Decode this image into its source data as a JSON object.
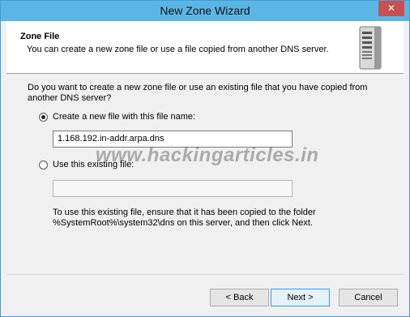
{
  "window": {
    "title": "New Zone Wizard",
    "close_glyph": "✕"
  },
  "header": {
    "title": "Zone File",
    "subtitle": "You can create a new zone file or use a file copied from another DNS server.",
    "icon": "server-icon"
  },
  "content": {
    "question": "Do you want to create a new zone file or use an existing file that you have copied from another DNS server?",
    "option_new": {
      "label": "Create a new file with this file name:",
      "checked": true,
      "value": "1.168.192.in-addr.arpa.dns"
    },
    "option_existing": {
      "label": "Use this existing file:",
      "checked": false,
      "value": ""
    },
    "note": "To use this existing file, ensure that it has been copied to the folder %SystemRoot%\\system32\\dns on this server, and then click Next.",
    "watermark": "www.hackingarticles.in"
  },
  "buttons": {
    "back": "< Back",
    "next": "Next >",
    "cancel": "Cancel"
  },
  "colors": {
    "titlebar": "#5bb6e6",
    "close": "#c75050",
    "accent": "#3399ff"
  }
}
